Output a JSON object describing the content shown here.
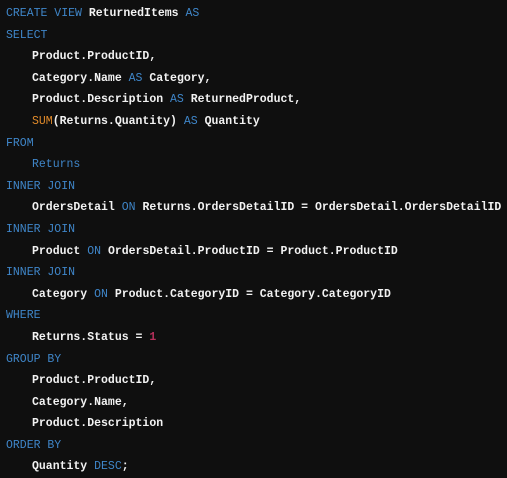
{
  "colors": {
    "background": "#0f0f0f",
    "keyword": "#3f86c9",
    "function": "#e08a2a",
    "number": "#b3305a",
    "identifier": "#f2f2f2"
  },
  "code_lines": [
    {
      "indent": false,
      "tokens": [
        [
          "kw",
          "CREATE VIEW "
        ],
        [
          "id",
          "ReturnedItems "
        ],
        [
          "kw",
          "AS"
        ]
      ]
    },
    {
      "indent": false,
      "tokens": [
        [
          "kw",
          "SELECT"
        ]
      ]
    },
    {
      "indent": true,
      "tokens": [
        [
          "id",
          "Product.ProductID,"
        ]
      ]
    },
    {
      "indent": true,
      "tokens": [
        [
          "id",
          "Category.Name "
        ],
        [
          "kw",
          "AS "
        ],
        [
          "id",
          "Category,"
        ]
      ]
    },
    {
      "indent": true,
      "tokens": [
        [
          "id",
          "Product.Description "
        ],
        [
          "kw",
          "AS "
        ],
        [
          "id",
          "ReturnedProduct,"
        ]
      ]
    },
    {
      "indent": true,
      "tokens": [
        [
          "fn",
          "SUM"
        ],
        [
          "id",
          "(Returns.Quantity) "
        ],
        [
          "kw",
          "AS "
        ],
        [
          "id",
          "Quantity"
        ]
      ]
    },
    {
      "indent": false,
      "tokens": [
        [
          "kw",
          "FROM"
        ]
      ]
    },
    {
      "indent": true,
      "tokens": [
        [
          "kw",
          "Returns"
        ]
      ]
    },
    {
      "indent": false,
      "tokens": [
        [
          "kw",
          "INNER JOIN"
        ]
      ]
    },
    {
      "indent": true,
      "tokens": [
        [
          "id",
          "OrdersDetail "
        ],
        [
          "kw",
          "ON "
        ],
        [
          "id",
          "Returns.OrdersDetailID = OrdersDetail.OrdersDetailID"
        ]
      ]
    },
    {
      "indent": false,
      "tokens": [
        [
          "kw",
          "INNER JOIN"
        ]
      ]
    },
    {
      "indent": true,
      "tokens": [
        [
          "id",
          "Product "
        ],
        [
          "kw",
          "ON "
        ],
        [
          "id",
          "OrdersDetail.ProductID = Product.ProductID"
        ]
      ]
    },
    {
      "indent": false,
      "tokens": [
        [
          "kw",
          "INNER JOIN"
        ]
      ]
    },
    {
      "indent": true,
      "tokens": [
        [
          "id",
          "Category "
        ],
        [
          "kw",
          "ON "
        ],
        [
          "id",
          "Product.CategoryID = Category.CategoryID"
        ]
      ]
    },
    {
      "indent": false,
      "tokens": [
        [
          "kw",
          "WHERE"
        ]
      ]
    },
    {
      "indent": true,
      "tokens": [
        [
          "id",
          "Returns.Status = "
        ],
        [
          "num",
          "1"
        ]
      ]
    },
    {
      "indent": false,
      "tokens": [
        [
          "kw",
          "GROUP BY"
        ]
      ]
    },
    {
      "indent": true,
      "tokens": [
        [
          "id",
          "Product.ProductID,"
        ]
      ]
    },
    {
      "indent": true,
      "tokens": [
        [
          "id",
          "Category.Name,"
        ]
      ]
    },
    {
      "indent": true,
      "tokens": [
        [
          "id",
          "Product.Description"
        ]
      ]
    },
    {
      "indent": false,
      "tokens": [
        [
          "kw",
          "ORDER BY"
        ]
      ]
    },
    {
      "indent": true,
      "tokens": [
        [
          "id",
          "Quantity "
        ],
        [
          "kw",
          "DESC"
        ],
        [
          "id",
          ";"
        ]
      ]
    }
  ]
}
